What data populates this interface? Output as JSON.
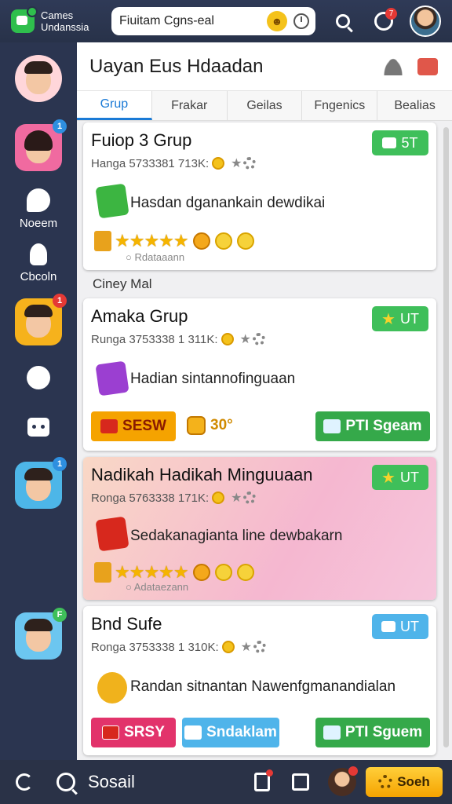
{
  "app": {
    "name_line1": "Cames",
    "name_line2": "Undanssia"
  },
  "search": {
    "value": "Fiuitam Cgns-eal"
  },
  "top_notification_badge": "7",
  "rail": {
    "items": [
      {
        "kind": "avatar",
        "badge": ""
      },
      {
        "kind": "avatar",
        "badge": "1"
      },
      {
        "kind": "icon",
        "label": "Noeem"
      },
      {
        "kind": "icon",
        "label": "Cbcoln"
      },
      {
        "kind": "avatar",
        "badge": "1"
      },
      {
        "kind": "icon",
        "label": ""
      },
      {
        "kind": "icon",
        "label": ""
      },
      {
        "kind": "avatar",
        "badge": "1"
      },
      {
        "kind": "avatar",
        "badge": "F"
      }
    ]
  },
  "main": {
    "title": "Uayan Eus Hdaadan",
    "tabs": [
      "Grup",
      "Frakar",
      "Geilas",
      "Fngenics",
      "Bealias"
    ],
    "section_label": "Ciney Mal"
  },
  "cards": [
    {
      "title": "Fuiop 3 Grup",
      "sub": "Hanga 5733381 713K:",
      "badge": "5T",
      "desc": "Hasdan dganankain dewdikai",
      "rating_label": "Rdataaann"
    },
    {
      "title": "Amaka Grup",
      "sub": "Runga 3753338 1 311K:",
      "badge": "UT",
      "desc": "Hadian sintannofinguaan",
      "btn_left": "SESW",
      "coin_count": "30°",
      "btn_right": "PTI Sgeam"
    },
    {
      "title": "Nadikah Hadikah Minguuaan",
      "sub": "Ronga 5763338 171K:",
      "badge": "UT",
      "desc": "Sedakanagianta line dewbakarn",
      "rating_label": "Adataezann"
    },
    {
      "title": "Bnd Sufe",
      "sub": "Ronga 3753338 1 310K:",
      "badge": "UT",
      "desc": "Randan sitnantan Nawenfgmanandialan",
      "btn_left": "SRSY",
      "btn_mid": "Sndaklam",
      "btn_right": "PTI Sguem"
    }
  ],
  "bottombar": {
    "label": "Sosail",
    "button": "Soeh"
  },
  "colors": {
    "rail_bg": "#2b3550",
    "accent_blue": "#1a7ad6",
    "badge_green": "#3fbf5a",
    "badge_blue": "#4fb4ea",
    "btn_orange": "#f5a300",
    "btn_green": "#35a94a"
  }
}
